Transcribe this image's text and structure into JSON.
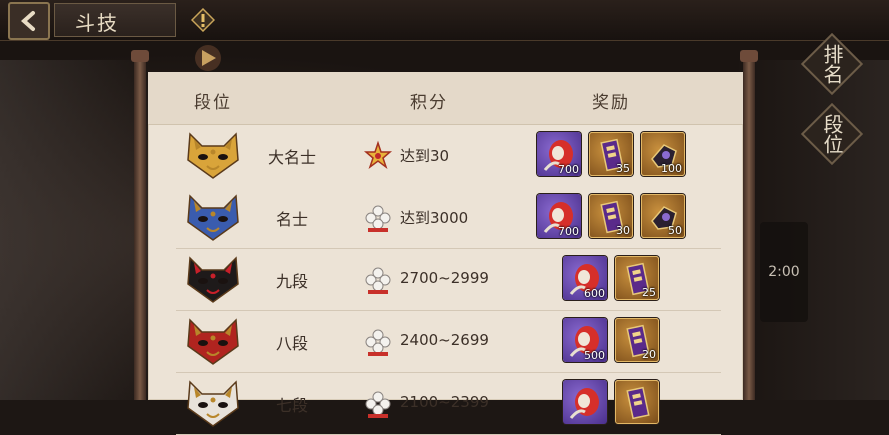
{
  "header": {
    "title": "斗技"
  },
  "side_buttons": {
    "leaderboard": "排名",
    "rank": "段位"
  },
  "timer_partial": "2:00",
  "table": {
    "columns": [
      "段位",
      "积分",
      "奖励"
    ],
    "rows": [
      {
        "rank": "大名士",
        "mask_color": "#d9a43a",
        "score_icon": "gold-star-medal-icon",
        "score": "达到30",
        "rewards": [
          {
            "type": "purple",
            "icon": "daruma-icon",
            "count": "700"
          },
          {
            "type": "gold",
            "icon": "talisman-icon",
            "count": "35"
          },
          {
            "type": "gold",
            "icon": "item-icon",
            "count": "100"
          }
        ]
      },
      {
        "rank": "名士",
        "mask_color": "#3a5cae",
        "score_icon": "white-flower-medal-icon",
        "score": "达到3000",
        "rewards": [
          {
            "type": "purple",
            "icon": "daruma-icon",
            "count": "700"
          },
          {
            "type": "gold",
            "icon": "talisman-icon",
            "count": "30"
          },
          {
            "type": "gold",
            "icon": "item-icon",
            "count": "50"
          }
        ]
      },
      {
        "rank": "九段",
        "mask_color": "#1e1a1a",
        "score_icon": "white-flower-medal-icon",
        "score": "2700~2999",
        "rewards": [
          {
            "type": "purple",
            "icon": "daruma-icon",
            "count": "600"
          },
          {
            "type": "gold",
            "icon": "talisman-icon",
            "count": "25"
          }
        ]
      },
      {
        "rank": "八段",
        "mask_color": "#b0241f",
        "score_icon": "white-flower-medal-icon",
        "score": "2400~2699",
        "rewards": [
          {
            "type": "purple",
            "icon": "daruma-icon",
            "count": "500"
          },
          {
            "type": "gold",
            "icon": "talisman-icon",
            "count": "20"
          }
        ]
      },
      {
        "rank": "七段",
        "mask_color": "#e8e2da",
        "score_icon": "white-flower-medal-icon",
        "score": "2100~2399",
        "rewards": [
          {
            "type": "purple",
            "icon": "daruma-icon",
            "count": ""
          },
          {
            "type": "gold",
            "icon": "talisman-icon",
            "count": ""
          }
        ]
      }
    ]
  }
}
